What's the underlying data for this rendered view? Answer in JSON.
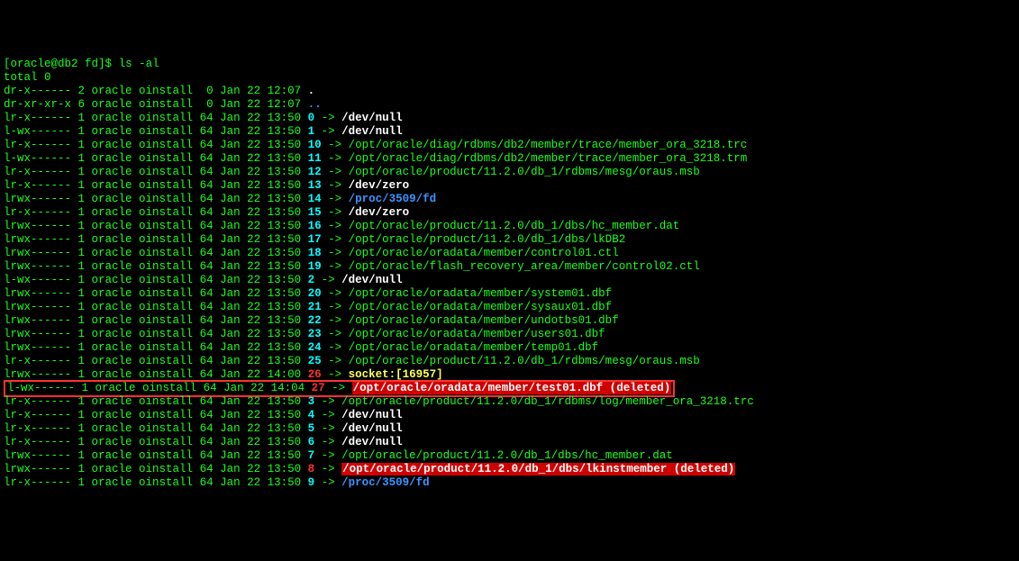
{
  "prompt": {
    "bracket_open": "[",
    "user_host": "oracle@db2 ",
    "cwd": "fd",
    "bracket_close": "]$ ",
    "cmd": "ls -al"
  },
  "total": "total 0",
  "rows": [
    {
      "perm": "dr-x------",
      "l": "2",
      "o": "oracle",
      "g": "oinstall",
      "s": " 0",
      "d": "Jan 22 12:07",
      "n": ".",
      "ncls": "white",
      "arrow": false
    },
    {
      "perm": "dr-xr-xr-x",
      "l": "6",
      "o": "oracle",
      "g": "oinstall",
      "s": " 0",
      "d": "Jan 22 12:07",
      "n": "..",
      "ncls": "blue",
      "arrow": false
    },
    {
      "perm": "lr-x------",
      "l": "1",
      "o": "oracle",
      "g": "oinstall",
      "s": "64",
      "d": "Jan 22 13:50",
      "n": "0",
      "ncls": "cyan",
      "arrow": true,
      "t": "/dev/null",
      "tcls": "white"
    },
    {
      "perm": "l-wx------",
      "l": "1",
      "o": "oracle",
      "g": "oinstall",
      "s": "64",
      "d": "Jan 22 13:50",
      "n": "1",
      "ncls": "cyan",
      "arrow": true,
      "t": "/dev/null",
      "tcls": "white"
    },
    {
      "perm": "lr-x------",
      "l": "1",
      "o": "oracle",
      "g": "oinstall",
      "s": "64",
      "d": "Jan 22 13:50",
      "n": "10",
      "ncls": "cyan",
      "arrow": true,
      "t": "/opt/oracle/diag/rdbms/db2/member/trace/member_ora_3218.trc",
      "tcls": "g"
    },
    {
      "perm": "l-wx------",
      "l": "1",
      "o": "oracle",
      "g": "oinstall",
      "s": "64",
      "d": "Jan 22 13:50",
      "n": "11",
      "ncls": "cyan",
      "arrow": true,
      "t": "/opt/oracle/diag/rdbms/db2/member/trace/member_ora_3218.trm",
      "tcls": "g"
    },
    {
      "perm": "lr-x------",
      "l": "1",
      "o": "oracle",
      "g": "oinstall",
      "s": "64",
      "d": "Jan 22 13:50",
      "n": "12",
      "ncls": "cyan",
      "arrow": true,
      "t": "/opt/oracle/product/11.2.0/db_1/rdbms/mesg/oraus.msb",
      "tcls": "g"
    },
    {
      "perm": "lr-x------",
      "l": "1",
      "o": "oracle",
      "g": "oinstall",
      "s": "64",
      "d": "Jan 22 13:50",
      "n": "13",
      "ncls": "cyan",
      "arrow": true,
      "t": "/dev/zero",
      "tcls": "white"
    },
    {
      "perm": "lrwx------",
      "l": "1",
      "o": "oracle",
      "g": "oinstall",
      "s": "64",
      "d": "Jan 22 13:50",
      "n": "14",
      "ncls": "cyan",
      "arrow": true,
      "t": "/proc/3509/fd",
      "tcls": "blue"
    },
    {
      "perm": "lr-x------",
      "l": "1",
      "o": "oracle",
      "g": "oinstall",
      "s": "64",
      "d": "Jan 22 13:50",
      "n": "15",
      "ncls": "cyan",
      "arrow": true,
      "t": "/dev/zero",
      "tcls": "white"
    },
    {
      "perm": "lrwx------",
      "l": "1",
      "o": "oracle",
      "g": "oinstall",
      "s": "64",
      "d": "Jan 22 13:50",
      "n": "16",
      "ncls": "cyan",
      "arrow": true,
      "t": "/opt/oracle/product/11.2.0/db_1/dbs/hc_member.dat",
      "tcls": "g"
    },
    {
      "perm": "lrwx------",
      "l": "1",
      "o": "oracle",
      "g": "oinstall",
      "s": "64",
      "d": "Jan 22 13:50",
      "n": "17",
      "ncls": "cyan",
      "arrow": true,
      "t": "/opt/oracle/product/11.2.0/db_1/dbs/lkDB2",
      "tcls": "g"
    },
    {
      "perm": "lrwx------",
      "l": "1",
      "o": "oracle",
      "g": "oinstall",
      "s": "64",
      "d": "Jan 22 13:50",
      "n": "18",
      "ncls": "cyan",
      "arrow": true,
      "t": "/opt/oracle/oradata/member/control01.ctl",
      "tcls": "g"
    },
    {
      "perm": "lrwx------",
      "l": "1",
      "o": "oracle",
      "g": "oinstall",
      "s": "64",
      "d": "Jan 22 13:50",
      "n": "19",
      "ncls": "cyan",
      "arrow": true,
      "t": "/opt/oracle/flash_recovery_area/member/control02.ctl",
      "tcls": "g"
    },
    {
      "perm": "l-wx------",
      "l": "1",
      "o": "oracle",
      "g": "oinstall",
      "s": "64",
      "d": "Jan 22 13:50",
      "n": "2",
      "ncls": "cyan",
      "arrow": true,
      "t": "/dev/null",
      "tcls": "white"
    },
    {
      "perm": "lrwx------",
      "l": "1",
      "o": "oracle",
      "g": "oinstall",
      "s": "64",
      "d": "Jan 22 13:50",
      "n": "20",
      "ncls": "cyan",
      "arrow": true,
      "t": "/opt/oracle/oradata/member/system01.dbf",
      "tcls": "g"
    },
    {
      "perm": "lrwx------",
      "l": "1",
      "o": "oracle",
      "g": "oinstall",
      "s": "64",
      "d": "Jan 22 13:50",
      "n": "21",
      "ncls": "cyan",
      "arrow": true,
      "t": "/opt/oracle/oradata/member/sysaux01.dbf",
      "tcls": "g"
    },
    {
      "perm": "lrwx------",
      "l": "1",
      "o": "oracle",
      "g": "oinstall",
      "s": "64",
      "d": "Jan 22 13:50",
      "n": "22",
      "ncls": "cyan",
      "arrow": true,
      "t": "/opt/oracle/oradata/member/undotbs01.dbf",
      "tcls": "g"
    },
    {
      "perm": "lrwx------",
      "l": "1",
      "o": "oracle",
      "g": "oinstall",
      "s": "64",
      "d": "Jan 22 13:50",
      "n": "23",
      "ncls": "cyan",
      "arrow": true,
      "t": "/opt/oracle/oradata/member/users01.dbf",
      "tcls": "g"
    },
    {
      "perm": "lrwx------",
      "l": "1",
      "o": "oracle",
      "g": "oinstall",
      "s": "64",
      "d": "Jan 22 13:50",
      "n": "24",
      "ncls": "cyan",
      "arrow": true,
      "t": "/opt/oracle/oradata/member/temp01.dbf",
      "tcls": "g"
    },
    {
      "perm": "lr-x------",
      "l": "1",
      "o": "oracle",
      "g": "oinstall",
      "s": "64",
      "d": "Jan 22 13:50",
      "n": "25",
      "ncls": "cyan",
      "arrow": true,
      "t": "/opt/oracle/product/11.2.0/db_1/rdbms/mesg/oraus.msb",
      "tcls": "g"
    },
    {
      "perm": "lrwx------",
      "l": "1",
      "o": "oracle",
      "g": "oinstall",
      "s": "64",
      "d": "Jan 22 14:00",
      "n": "26",
      "ncls": "red",
      "arrow": true,
      "t": "socket:[16957]",
      "tcls": "yellow"
    },
    {
      "perm": "l-wx------",
      "l": "1",
      "o": "oracle",
      "g": "oinstall",
      "s": "64",
      "d": "Jan 22 14:04",
      "n": "27",
      "ncls": "red",
      "arrow": true,
      "t": "/opt/oracle/oradata/member/test01.dbf (deleted)",
      "tcls": "bgred",
      "boxed": true
    },
    {
      "perm": "lr-x------",
      "l": "1",
      "o": "oracle",
      "g": "oinstall",
      "s": "64",
      "d": "Jan 22 13:50",
      "n": "3",
      "ncls": "cyan",
      "arrow": true,
      "t": "/opt/oracle/product/11.2.0/db_1/rdbms/log/member_ora_3218.trc",
      "tcls": "g"
    },
    {
      "perm": "lr-x------",
      "l": "1",
      "o": "oracle",
      "g": "oinstall",
      "s": "64",
      "d": "Jan 22 13:50",
      "n": "4",
      "ncls": "cyan",
      "arrow": true,
      "t": "/dev/null",
      "tcls": "white"
    },
    {
      "perm": "lr-x------",
      "l": "1",
      "o": "oracle",
      "g": "oinstall",
      "s": "64",
      "d": "Jan 22 13:50",
      "n": "5",
      "ncls": "cyan",
      "arrow": true,
      "t": "/dev/null",
      "tcls": "white"
    },
    {
      "perm": "lr-x------",
      "l": "1",
      "o": "oracle",
      "g": "oinstall",
      "s": "64",
      "d": "Jan 22 13:50",
      "n": "6",
      "ncls": "cyan",
      "arrow": true,
      "t": "/dev/null",
      "tcls": "white"
    },
    {
      "perm": "lrwx------",
      "l": "1",
      "o": "oracle",
      "g": "oinstall",
      "s": "64",
      "d": "Jan 22 13:50",
      "n": "7",
      "ncls": "cyan",
      "arrow": true,
      "t": "/opt/oracle/product/11.2.0/db_1/dbs/hc_member.dat",
      "tcls": "g"
    },
    {
      "perm": "lrwx------",
      "l": "1",
      "o": "oracle",
      "g": "oinstall",
      "s": "64",
      "d": "Jan 22 13:50",
      "n": "8",
      "ncls": "red",
      "arrow": true,
      "t": "/opt/oracle/product/11.2.0/db_1/dbs/lkinstmember (deleted)",
      "tcls": "bgred"
    },
    {
      "perm": "lr-x------",
      "l": "1",
      "o": "oracle",
      "g": "oinstall",
      "s": "64",
      "d": "Jan 22 13:50",
      "n": "9",
      "ncls": "cyan",
      "arrow": true,
      "t": "/proc/3509/fd",
      "tcls": "blue"
    }
  ],
  "arrow": " -> "
}
